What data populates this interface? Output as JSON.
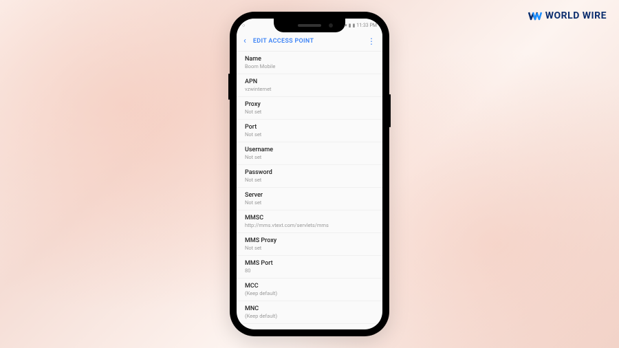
{
  "logo": {
    "text": "WORLD WIRE"
  },
  "status": {
    "time": "11:33 PM"
  },
  "header": {
    "title": "EDIT ACCESS POINT"
  },
  "settings": [
    {
      "label": "Name",
      "value": "Boom Mobile"
    },
    {
      "label": "APN",
      "value": "vzwinternet"
    },
    {
      "label": "Proxy",
      "value": "Not set"
    },
    {
      "label": "Port",
      "value": "Not set"
    },
    {
      "label": "Username",
      "value": "Not set"
    },
    {
      "label": "Password",
      "value": "Not set"
    },
    {
      "label": "Server",
      "value": "Not set"
    },
    {
      "label": "MMSC",
      "value": "http://mms.vtext.com/servlets/mms"
    },
    {
      "label": "MMS Proxy",
      "value": "Not set"
    },
    {
      "label": "MMS Port",
      "value": "80"
    },
    {
      "label": "MCC",
      "value": "(Keep default)"
    },
    {
      "label": "MNC",
      "value": "(Keep default)"
    }
  ]
}
